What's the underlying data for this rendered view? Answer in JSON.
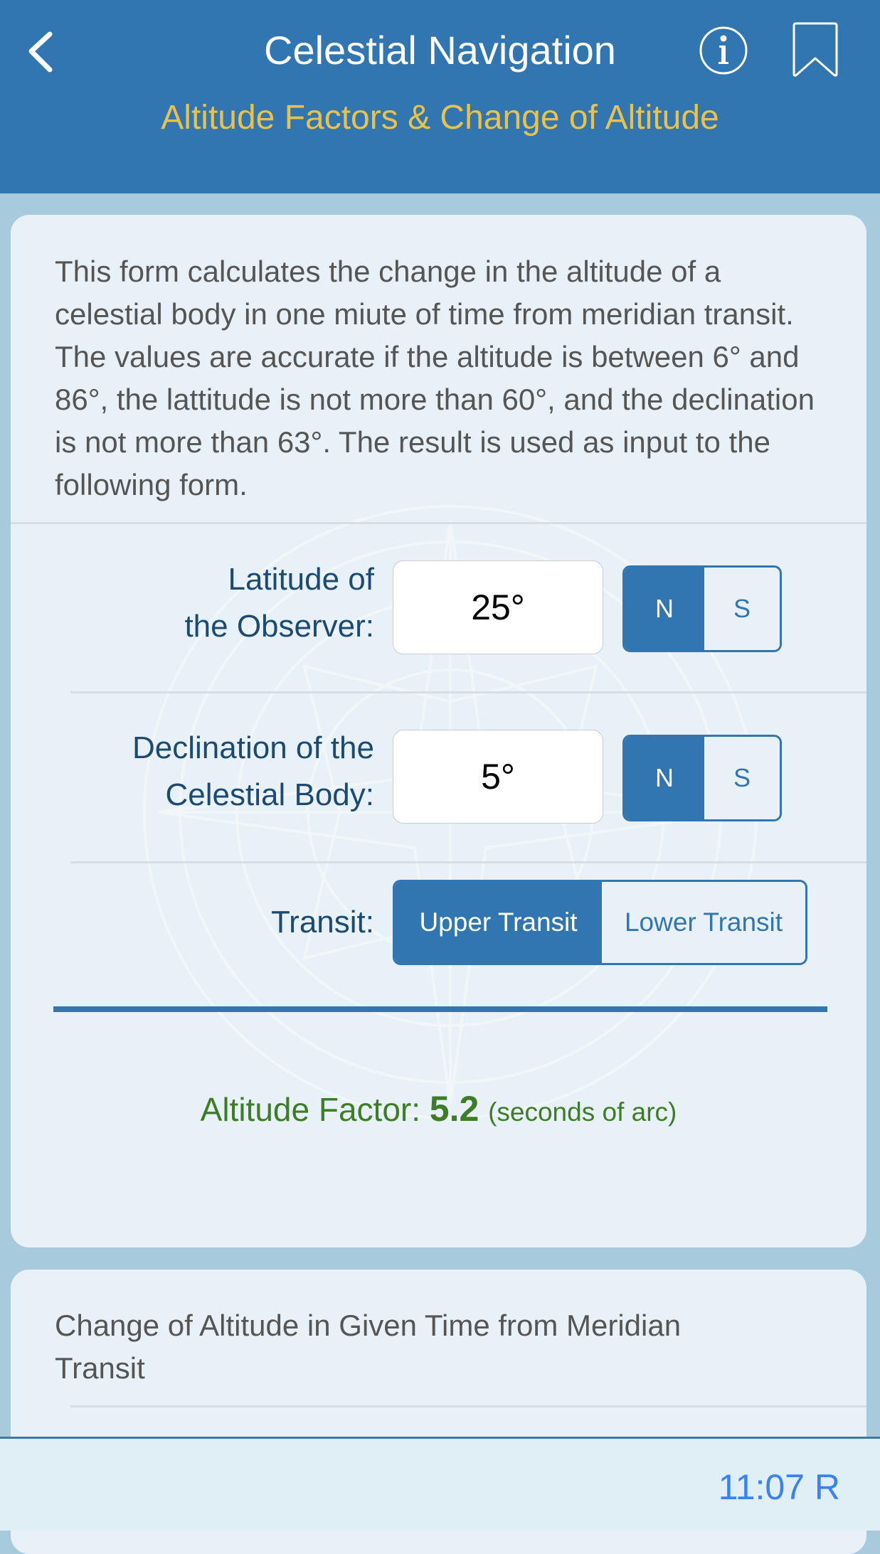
{
  "header": {
    "title": "Celestial Navigation",
    "subtitle": "Altitude Factors & Change of Altitude",
    "back_icon": "chevron-left-icon",
    "info_icon": "info-circle-icon",
    "bookmark_icon": "bookmark-icon"
  },
  "form": {
    "description": "This form calculates the change in the altitude of a celestial body in one miute of time from meridian transit. The values are accurate if the altitude is between 6° and 86°, the lattitude is not more than 60°, and the declination is not more than 63°. The result is used as input to the following form.",
    "latitude": {
      "label_line1": "Latitude of",
      "label_line2": "the Observer:",
      "value": "25°",
      "options": [
        "N",
        "S"
      ],
      "selected": "N"
    },
    "declination": {
      "label_line1": "Declination of the",
      "label_line2": "Celestial Body:",
      "value": "5°",
      "options": [
        "N",
        "S"
      ],
      "selected": "N"
    },
    "transit": {
      "label": "Transit:",
      "options": [
        "Upper Transit",
        "Lower Transit"
      ],
      "selected": "Upper Transit"
    },
    "result": {
      "label": "Altitude Factor:",
      "value": "5.2",
      "unit": "(seconds of arc)"
    }
  },
  "next_form": {
    "title": "Change of Altitude in Given Time from Meridian Transit"
  },
  "status": {
    "time": "11:07 R"
  },
  "colors": {
    "header_bg": "#3276b1",
    "subtitle": "#e8c24c",
    "accent": "#3276b1",
    "result_green": "#3e7d28",
    "time_blue": "#3a82f0"
  }
}
